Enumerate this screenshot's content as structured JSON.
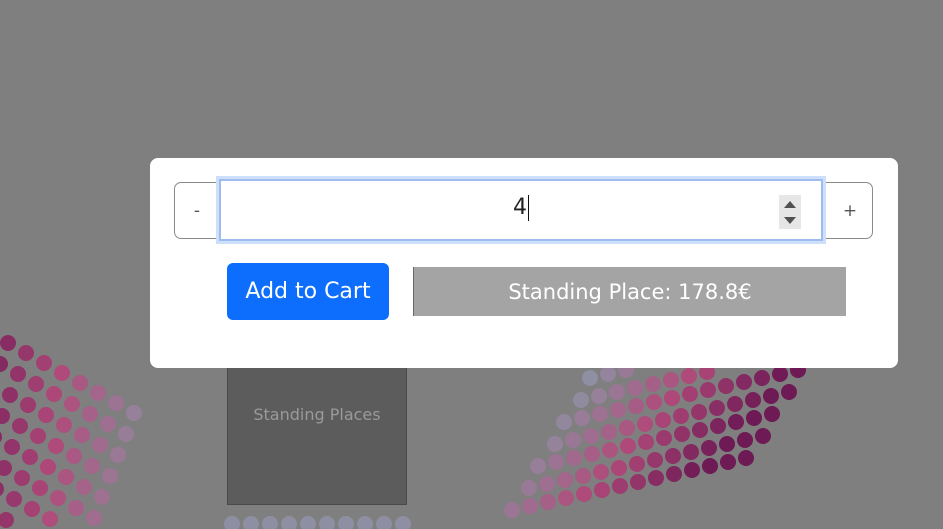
{
  "stage": {
    "section_label": "Standing Places"
  },
  "modal": {
    "quantity": {
      "decrement_label": "-",
      "value": "4",
      "increment_label": "+"
    },
    "add_to_cart_label": "Add to Cart",
    "price_text": "Standing Place: 178.8€"
  },
  "colors": {
    "backdrop": "#7f7f7f",
    "primary_button": "#0d6efd",
    "price_box": "#a4a4a4",
    "seat_gray": "#8f8fa3",
    "seat_pink": "#b04a7a",
    "seat_dark": "#6e1a55"
  }
}
